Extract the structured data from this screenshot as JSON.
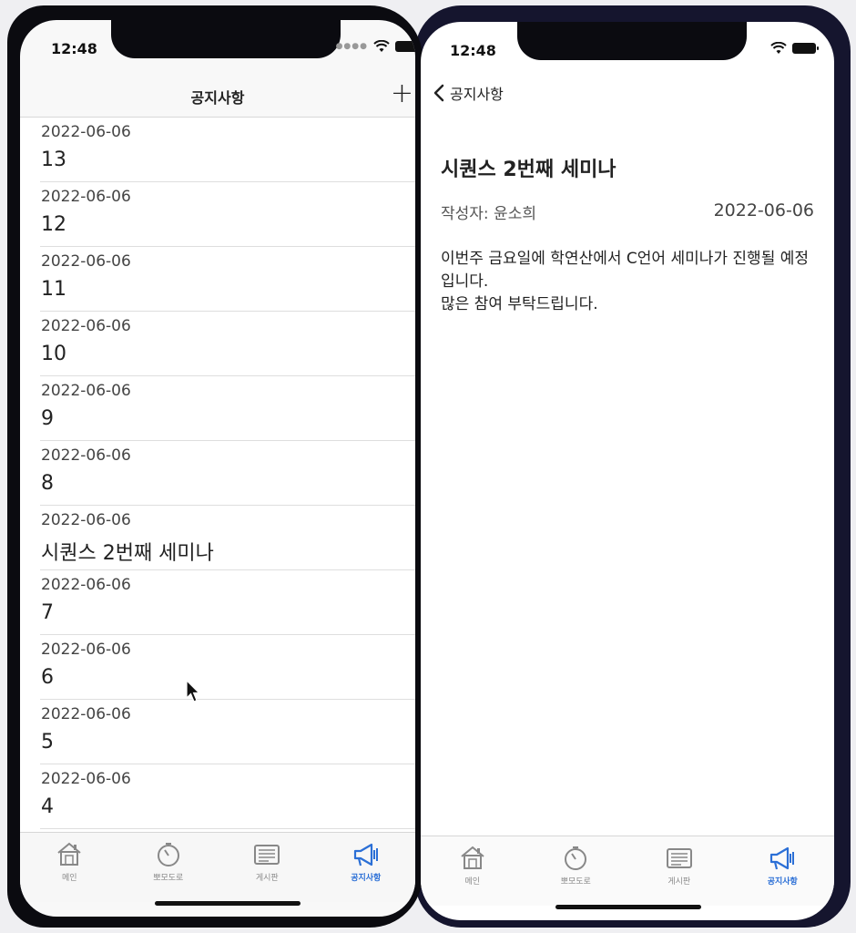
{
  "left_screen": {
    "status": {
      "time": "12:48"
    },
    "nav": {
      "title": "공지사항",
      "add_label": "+"
    },
    "notices": [
      {
        "date": "2022-06-06",
        "title": "13"
      },
      {
        "date": "2022-06-06",
        "title": "12"
      },
      {
        "date": "2022-06-06",
        "title": "11"
      },
      {
        "date": "2022-06-06",
        "title": "10"
      },
      {
        "date": "2022-06-06",
        "title": "9"
      },
      {
        "date": "2022-06-06",
        "title": "8"
      },
      {
        "date": "2022-06-06",
        "title": "시퀀스 2번째 세미나"
      },
      {
        "date": "2022-06-06",
        "title": "7"
      },
      {
        "date": "2022-06-06",
        "title": "6"
      },
      {
        "date": "2022-06-06",
        "title": "5"
      },
      {
        "date": "2022-06-06",
        "title": "4"
      }
    ]
  },
  "right_screen": {
    "status": {
      "time": "12:48"
    },
    "back_label": "공지사항",
    "detail": {
      "title": "시퀀스 2번째 세미나",
      "author": "작성자: 윤소희",
      "date": "2022-06-06",
      "body": "이번주 금요일에 학연산에서  C언어 세미나가 진행될 예정입니다.\n많은 참여 부탁드립니다."
    }
  },
  "tabs": [
    {
      "label": "메인",
      "icon": "home-icon"
    },
    {
      "label": "뽀모도로",
      "icon": "timer-icon"
    },
    {
      "label": "게시판",
      "icon": "board-icon"
    },
    {
      "label": "공지사항",
      "icon": "megaphone-icon",
      "active": true
    }
  ],
  "colors": {
    "accent": "#2b6fd6",
    "inactive": "#888888"
  }
}
